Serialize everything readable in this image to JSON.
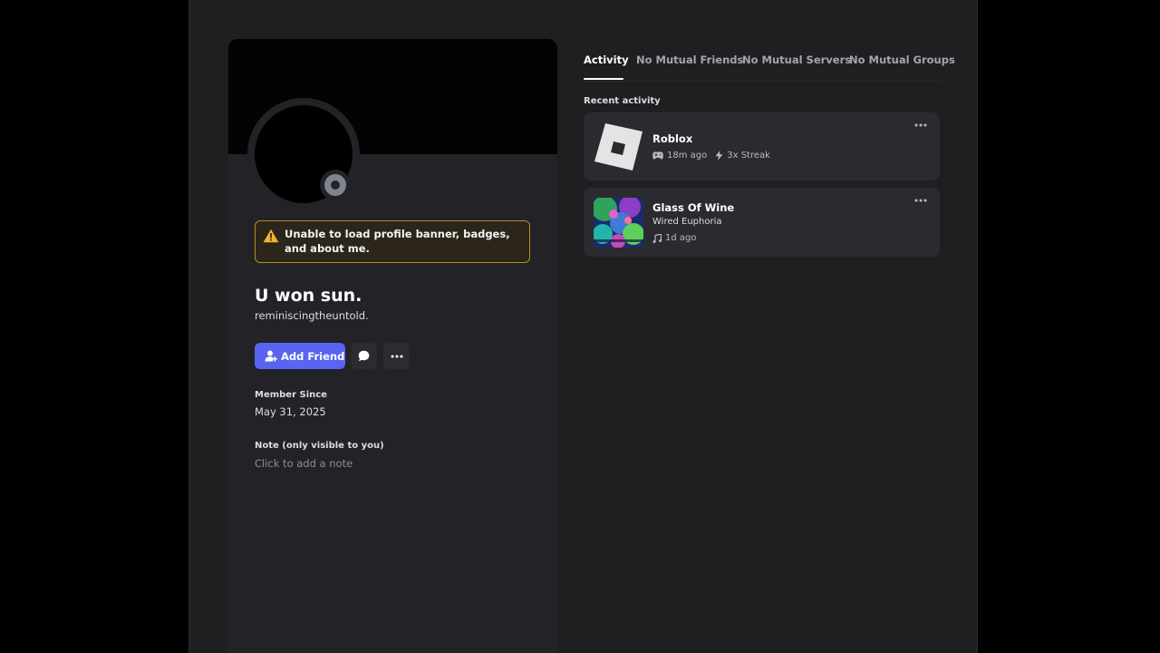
{
  "profile": {
    "warning_text": "Unable to load profile banner, badges, and about me.",
    "display_name": "U won sun.",
    "username": "reminiscingtheuntold.",
    "add_friend_label": "Add Friend",
    "member_since_label": "Member Since",
    "member_since_value": "May 31, 2025",
    "note_label": "Note (only visible to you)",
    "note_placeholder": "Click to add a note"
  },
  "tabs": [
    {
      "label": "Activity",
      "active": true
    },
    {
      "label": "No Mutual Friends",
      "active": false
    },
    {
      "label": "No Mutual Servers",
      "active": false
    },
    {
      "label": "No Mutual Groups",
      "active": false
    }
  ],
  "recent_activity_label": "Recent activity",
  "activities": [
    {
      "title": "Roblox",
      "time": "18m ago",
      "streak": "3x Streak",
      "icon": "gamepad-icon"
    },
    {
      "title": "Glass Of Wine",
      "artist": "Wired Euphoria",
      "time": "1d ago",
      "icon": "music-note-icon"
    }
  ],
  "colors": {
    "accent": "#5865f2",
    "warning_border": "#b98b26",
    "warning_icon": "#f0b232",
    "status_offline": "#80848e"
  }
}
